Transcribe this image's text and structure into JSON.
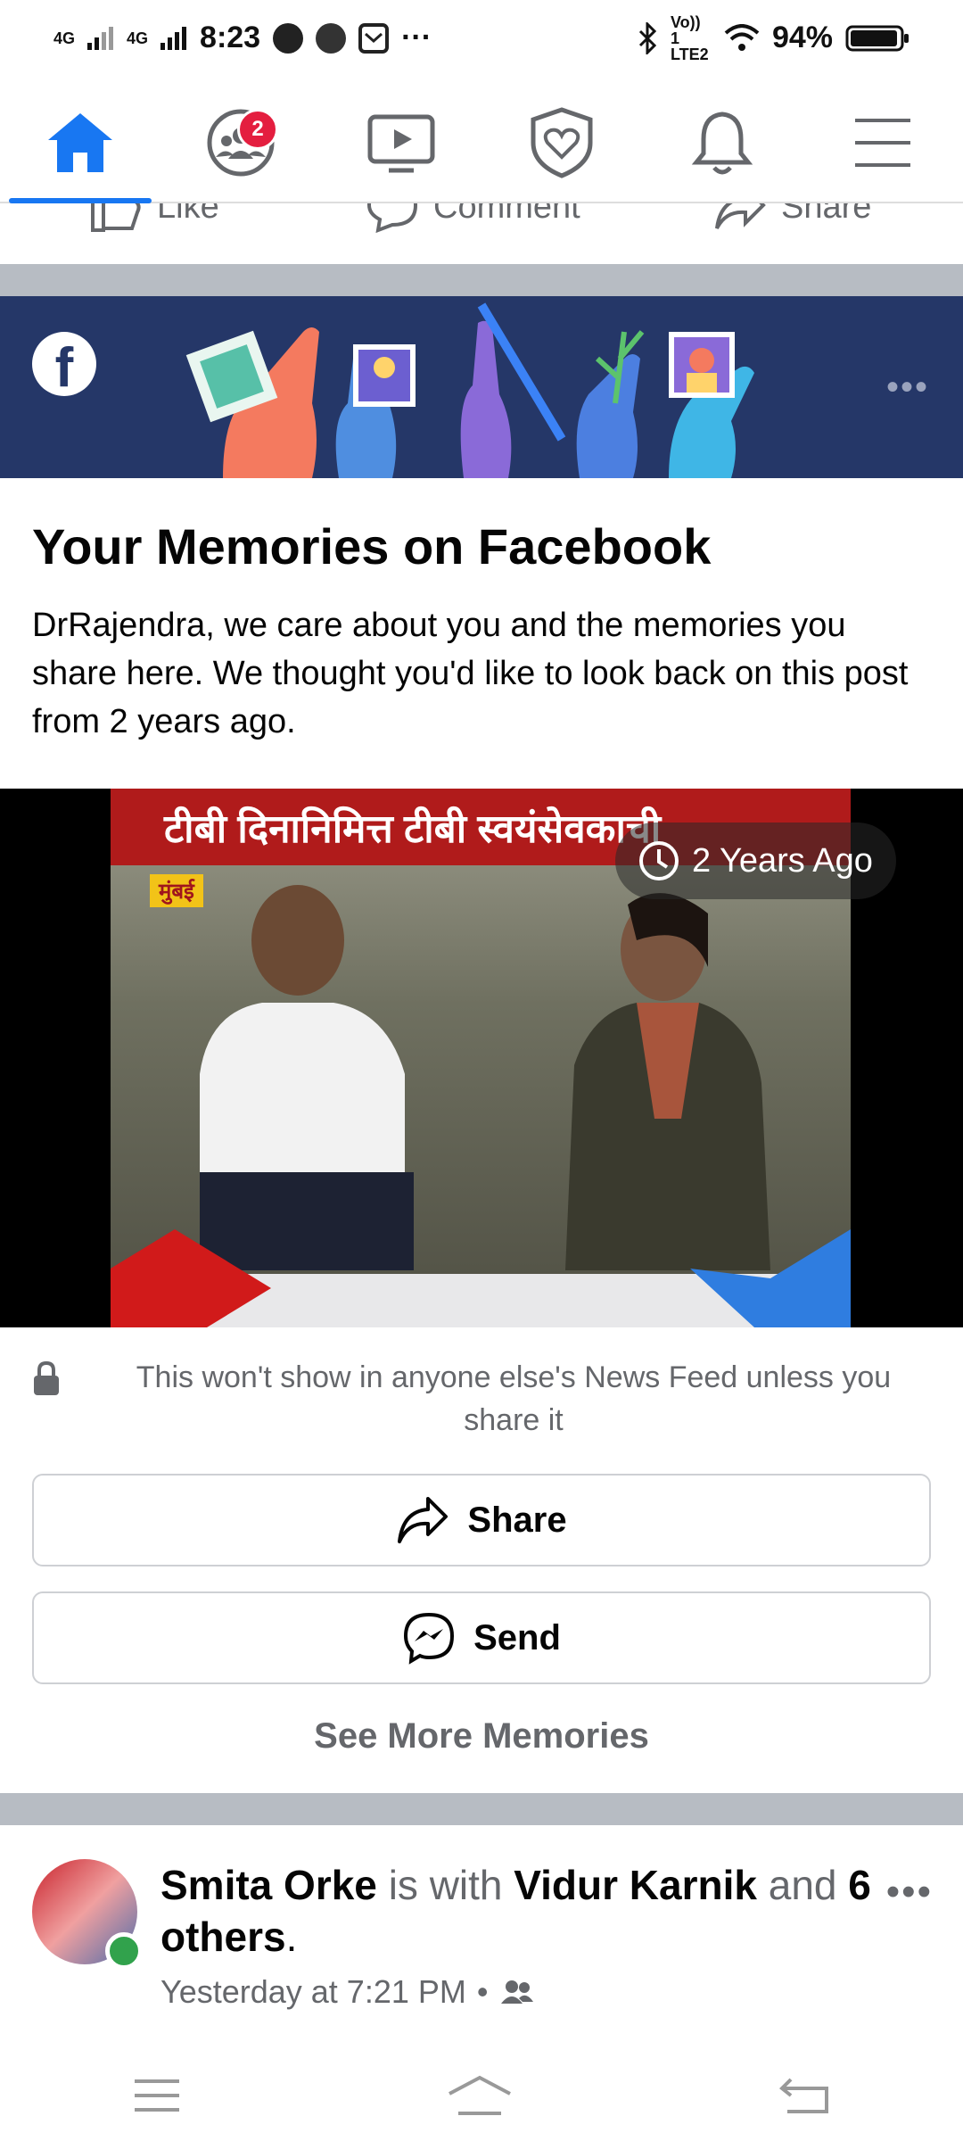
{
  "status_bar": {
    "net1": "4G",
    "net2": "4G",
    "time": "8:23",
    "more": "···",
    "volte": "Vo)) 1 LTE2",
    "battery": "94%"
  },
  "nav": {
    "groups_badge": "2",
    "accent": "#1877f2",
    "items": [
      "home-icon",
      "groups-icon",
      "watch-icon",
      "shield-heart-icon",
      "bell-icon",
      "menu-icon"
    ]
  },
  "prev_post_actions": {
    "like": "Like",
    "comment": "Comment",
    "share": "Share"
  },
  "memory": {
    "title": "Your Memories on Facebook",
    "description": "DrRajendra, we care about you and the memories you share here. We thought you'd like to look back on this post from 2 years ago.",
    "video_caption": "टीबी दिनानिमित्त टीबी स्वयंसेवकाची",
    "video_tag": "मुंबई",
    "ago_label": "2 Years Ago",
    "privacy_note": "This won't show in anyone else's News Feed unless you share it",
    "share_label": "Share",
    "send_label": "Send",
    "see_more_label": "See More Memories"
  },
  "post": {
    "author": "Smita Orke",
    "is_with": "is with",
    "tagged": "Vidur Karnik",
    "and": "and",
    "others": "6 others",
    "period": ".",
    "time": "Yesterday at 7:21 PM",
    "dot": "•",
    "more": "•••"
  }
}
